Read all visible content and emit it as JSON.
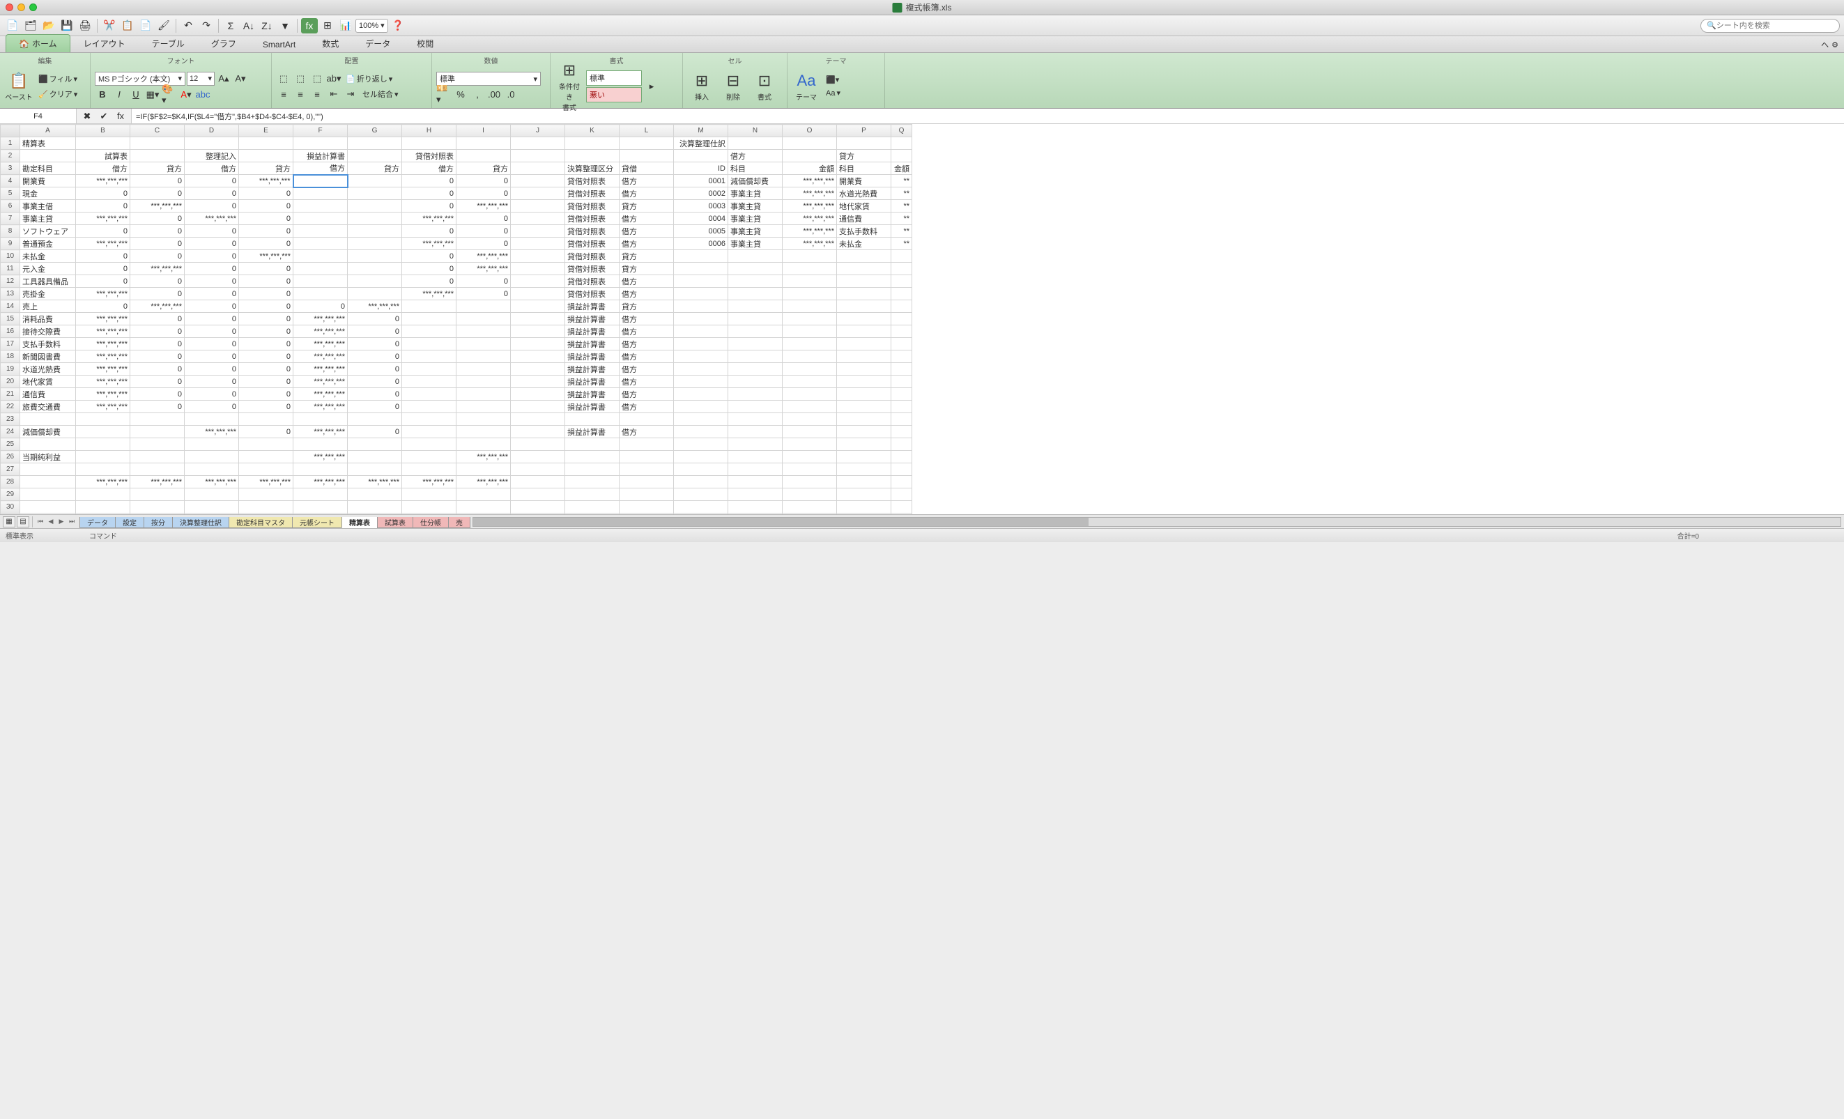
{
  "window": {
    "title": "複式帳簿.xls"
  },
  "search_placeholder": "シート内を検索",
  "zoom": "100%",
  "ribbon_tabs": [
    "ホーム",
    "レイアウト",
    "テーブル",
    "グラフ",
    "SmartArt",
    "数式",
    "データ",
    "校閲"
  ],
  "ribbon": {
    "groups": [
      "編集",
      "フォント",
      "配置",
      "数値",
      "書式",
      "セル",
      "テーマ"
    ],
    "paste": "ペースト",
    "fill": "フィル",
    "clear": "クリア",
    "font_name": "MS Pゴシック (本文)",
    "font_size": "12",
    "wrap": "折り返し",
    "merge": "セル結合",
    "num_format": "標準",
    "cond_fmt": "条件付き\n書式",
    "style_normal": "標準",
    "style_bad": "悪い",
    "insert": "挿入",
    "delete": "削除",
    "format": "書式",
    "theme": "テーマ",
    "aa": "Aa"
  },
  "name_box": "F4",
  "formula": "=IF($F$2=$K4,IF($L4=\"借方\",$B4+$D4-$C4-$E4, 0),\"\")",
  "columns": [
    "A",
    "B",
    "C",
    "D",
    "E",
    "F",
    "G",
    "H",
    "I",
    "J",
    "K",
    "L",
    "M",
    "N",
    "O",
    "P",
    "Q"
  ],
  "rows": [
    {
      "r": 1,
      "c": {
        "A": "精算表",
        "M": "決算整理仕訳"
      }
    },
    {
      "r": 2,
      "c": {
        "B": "試算表",
        "D": "整理記入",
        "F": "損益計算書",
        "H": "貸借対照表",
        "N": "借方",
        "P": "貸方"
      }
    },
    {
      "r": 3,
      "c": {
        "A": "勘定科目",
        "B": "借方",
        "C": "貸方",
        "D": "借方",
        "E": "貸方",
        "F": "借方",
        "G": "貸方",
        "H": "借方",
        "I": "貸方",
        "K": "決算整理区分",
        "L": "貸借",
        "M": "ID",
        "N": "科目",
        "O": "金額",
        "P": "科目",
        "Q": "金額"
      }
    },
    {
      "r": 4,
      "c": {
        "A": "開業費",
        "B": "***,***,***",
        "C": "0",
        "D": "0",
        "E": "***,***,***",
        "H": "0",
        "I": "0",
        "K": "貸借対照表",
        "L": "借方",
        "M": "0001",
        "N": "減価償却費",
        "O": "***,***,***",
        "P": "開業費",
        "Q": "**"
      }
    },
    {
      "r": 5,
      "c": {
        "A": "現金",
        "B": "0",
        "C": "0",
        "D": "0",
        "E": "0",
        "H": "0",
        "I": "0",
        "K": "貸借対照表",
        "L": "借方",
        "M": "0002",
        "N": "事業主貸",
        "O": "***,***,***",
        "P": "水道光熱費",
        "Q": "**"
      }
    },
    {
      "r": 6,
      "c": {
        "A": "事業主借",
        "B": "0",
        "C": "***,***,***",
        "D": "0",
        "E": "0",
        "H": "0",
        "I": "***,***,***",
        "K": "貸借対照表",
        "L": "貸方",
        "M": "0003",
        "N": "事業主貸",
        "O": "***,***,***",
        "P": "地代家賃",
        "Q": "**"
      }
    },
    {
      "r": 7,
      "c": {
        "A": "事業主貸",
        "B": "***,***,***",
        "C": "0",
        "D": "***,***,***",
        "E": "0",
        "H": "***,***,***",
        "I": "0",
        "K": "貸借対照表",
        "L": "借方",
        "M": "0004",
        "N": "事業主貸",
        "O": "***,***,***",
        "P": "通信費",
        "Q": "**"
      }
    },
    {
      "r": 8,
      "c": {
        "A": "ソフトウェア",
        "B": "0",
        "C": "0",
        "D": "0",
        "E": "0",
        "H": "0",
        "I": "0",
        "K": "貸借対照表",
        "L": "借方",
        "M": "0005",
        "N": "事業主貸",
        "O": "***,***,***",
        "P": "支払手数料",
        "Q": "**"
      }
    },
    {
      "r": 9,
      "c": {
        "A": "普通預金",
        "B": "***,***,***",
        "C": "0",
        "D": "0",
        "E": "0",
        "H": "***,***,***",
        "I": "0",
        "K": "貸借対照表",
        "L": "借方",
        "M": "0006",
        "N": "事業主貸",
        "O": "***,***,***",
        "P": "未払金",
        "Q": "**"
      }
    },
    {
      "r": 10,
      "c": {
        "A": "未払金",
        "B": "0",
        "C": "0",
        "D": "0",
        "E": "***,***,***",
        "H": "0",
        "I": "***,***,***",
        "K": "貸借対照表",
        "L": "貸方"
      }
    },
    {
      "r": 11,
      "c": {
        "A": "元入金",
        "B": "0",
        "C": "***,***,***",
        "D": "0",
        "E": "0",
        "H": "0",
        "I": "***,***,***",
        "K": "貸借対照表",
        "L": "貸方"
      }
    },
    {
      "r": 12,
      "c": {
        "A": "工具器具備品",
        "B": "0",
        "C": "0",
        "D": "0",
        "E": "0",
        "H": "0",
        "I": "0",
        "K": "貸借対照表",
        "L": "借方"
      }
    },
    {
      "r": 13,
      "c": {
        "A": "売掛金",
        "B": "***,***,***",
        "C": "0",
        "D": "0",
        "E": "0",
        "H": "***,***,***",
        "I": "0",
        "K": "貸借対照表",
        "L": "借方"
      }
    },
    {
      "r": 14,
      "c": {
        "A": "売上",
        "B": "0",
        "C": "***,***,***",
        "D": "0",
        "E": "0",
        "F": "0",
        "G": "***,***,***",
        "K": "損益計算書",
        "L": "貸方"
      }
    },
    {
      "r": 15,
      "c": {
        "A": "消耗品費",
        "B": "***,***,***",
        "C": "0",
        "D": "0",
        "E": "0",
        "F": "***,***,***",
        "G": "0",
        "K": "損益計算書",
        "L": "借方"
      }
    },
    {
      "r": 16,
      "c": {
        "A": "接待交際費",
        "B": "***,***,***",
        "C": "0",
        "D": "0",
        "E": "0",
        "F": "***,***,***",
        "G": "0",
        "K": "損益計算書",
        "L": "借方"
      }
    },
    {
      "r": 17,
      "c": {
        "A": "支払手数料",
        "B": "***,***,***",
        "C": "0",
        "D": "0",
        "E": "0",
        "F": "***,***,***",
        "G": "0",
        "K": "損益計算書",
        "L": "借方"
      }
    },
    {
      "r": 18,
      "c": {
        "A": "新聞図書費",
        "B": "***,***,***",
        "C": "0",
        "D": "0",
        "E": "0",
        "F": "***,***,***",
        "G": "0",
        "K": "損益計算書",
        "L": "借方"
      }
    },
    {
      "r": 19,
      "c": {
        "A": "水道光熱費",
        "B": "***,***,***",
        "C": "0",
        "D": "0",
        "E": "0",
        "F": "***,***,***",
        "G": "0",
        "K": "損益計算書",
        "L": "借方"
      }
    },
    {
      "r": 20,
      "c": {
        "A": "地代家賃",
        "B": "***,***,***",
        "C": "0",
        "D": "0",
        "E": "0",
        "F": "***,***,***",
        "G": "0",
        "K": "損益計算書",
        "L": "借方"
      }
    },
    {
      "r": 21,
      "c": {
        "A": "通信費",
        "B": "***,***,***",
        "C": "0",
        "D": "0",
        "E": "0",
        "F": "***,***,***",
        "G": "0",
        "K": "損益計算書",
        "L": "借方"
      }
    },
    {
      "r": 22,
      "c": {
        "A": "旅費交通費",
        "B": "***,***,***",
        "C": "0",
        "D": "0",
        "E": "0",
        "F": "***,***,***",
        "G": "0",
        "K": "損益計算書",
        "L": "借方"
      }
    },
    {
      "r": 23,
      "c": {}
    },
    {
      "r": 24,
      "c": {
        "A": "減価償却費",
        "D": "***,***,***",
        "E": "0",
        "F": "***,***,***",
        "G": "0",
        "K": "損益計算書",
        "L": "借方"
      }
    },
    {
      "r": 25,
      "c": {}
    },
    {
      "r": 26,
      "c": {
        "A": "当期純利益",
        "F": "***,***,***",
        "I": "***,***,***"
      }
    },
    {
      "r": 27,
      "c": {}
    },
    {
      "r": 28,
      "c": {
        "B": "***,***,***",
        "C": "***,***,***",
        "D": "***,***,***",
        "E": "***,***,***",
        "F": "***,***,***",
        "G": "***,***,***",
        "H": "***,***,***",
        "I": "***,***,***"
      }
    },
    {
      "r": 29,
      "c": {}
    },
    {
      "r": 30,
      "c": {}
    },
    {
      "r": 31,
      "c": {}
    },
    {
      "r": 32,
      "c": {}
    }
  ],
  "sheet_tabs": [
    {
      "label": "データ",
      "cls": "blue"
    },
    {
      "label": "設定",
      "cls": "blue"
    },
    {
      "label": "按分",
      "cls": "blue"
    },
    {
      "label": "決算整理仕訳",
      "cls": "blue"
    },
    {
      "label": "勘定科目マスタ",
      "cls": "yellow"
    },
    {
      "label": "元帳シート",
      "cls": "yellow"
    },
    {
      "label": "精算表",
      "cls": "red active"
    },
    {
      "label": "試算表",
      "cls": "red"
    },
    {
      "label": "仕分帳",
      "cls": "red"
    },
    {
      "label": "売",
      "cls": "red"
    }
  ],
  "status": {
    "view": "標準表示",
    "cmd": "コマンド",
    "sum": "合計=0"
  }
}
